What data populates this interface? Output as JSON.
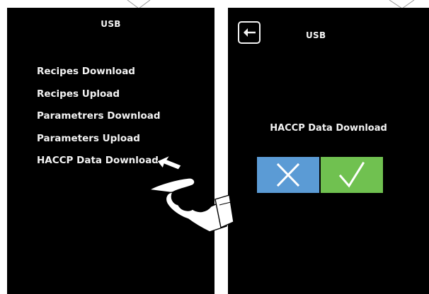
{
  "screens": {
    "left": {
      "title": "USB",
      "menu_items": [
        {
          "label": "Recipes Download"
        },
        {
          "label": "Recipes Upload"
        },
        {
          "label": "Parametrers Download"
        },
        {
          "label": "Parameters Upload"
        },
        {
          "label": "HACCP Data Download"
        }
      ],
      "pointer_icon": "hand-pointer-icon"
    },
    "right": {
      "title": "USB",
      "back_icon": "back-arrow-icon",
      "prompt": "HACCP Data Download",
      "cancel_icon": "x-icon",
      "confirm_icon": "checkmark-icon"
    }
  },
  "colors": {
    "screen_background": "#000000",
    "text": "#f2f2f2",
    "cancel_button": "#5b9bd5",
    "confirm_button": "#70c150"
  }
}
